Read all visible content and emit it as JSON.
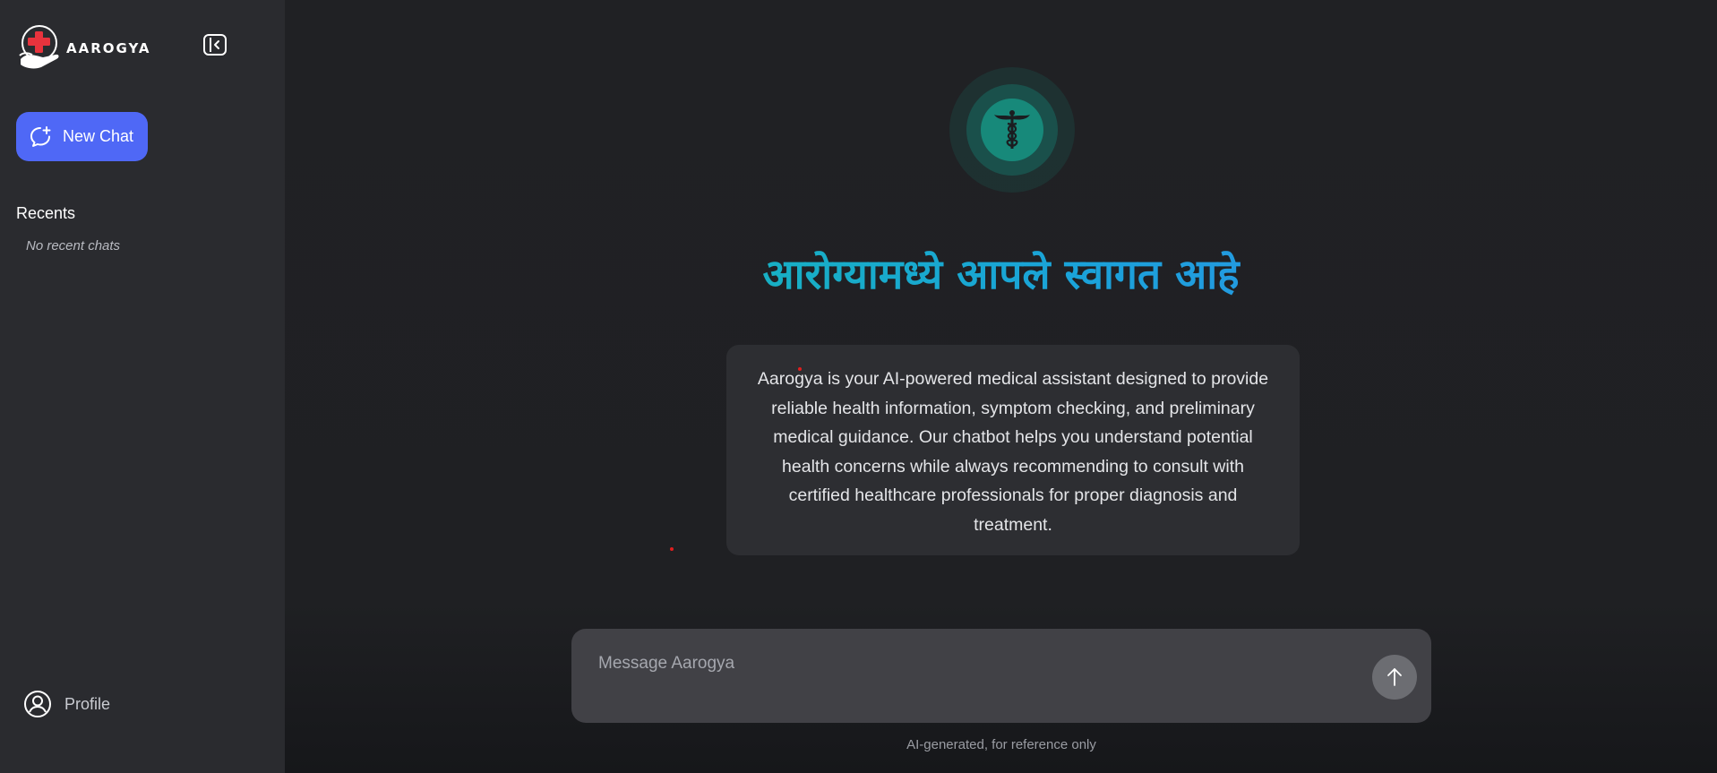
{
  "sidebar": {
    "brand": "AAROGYA",
    "new_chat_label": "New Chat",
    "recents_title": "Recents",
    "no_recent_text": "No recent chats",
    "profile_label": "Profile"
  },
  "main": {
    "welcome_title": "आरोग्यामध्ये आपले स्वागत आहे",
    "description": "Aarogya is your AI-powered medical assistant designed to provide reliable health information, symptom checking, and preliminary medical guidance. Our chatbot helps you understand potential health concerns while always recommending to consult with certified healthcare professionals for proper diagnosis and treatment.",
    "composer_placeholder": "Message Aarogya",
    "disclaimer": "AI-generated, for reference only"
  },
  "icons": {
    "logo": "hand-heart-cross-logo",
    "collapse": "sidebar-collapse-icon",
    "new_chat": "chat-plus-icon",
    "profile": "user-circle-icon",
    "hero": "caduceus-icon",
    "send": "arrow-up-icon"
  },
  "colors": {
    "accent": "#4f68f6",
    "teal": "#17897a",
    "sidebar_bg": "#2a2b2f",
    "main_bg": "#1f2023"
  }
}
